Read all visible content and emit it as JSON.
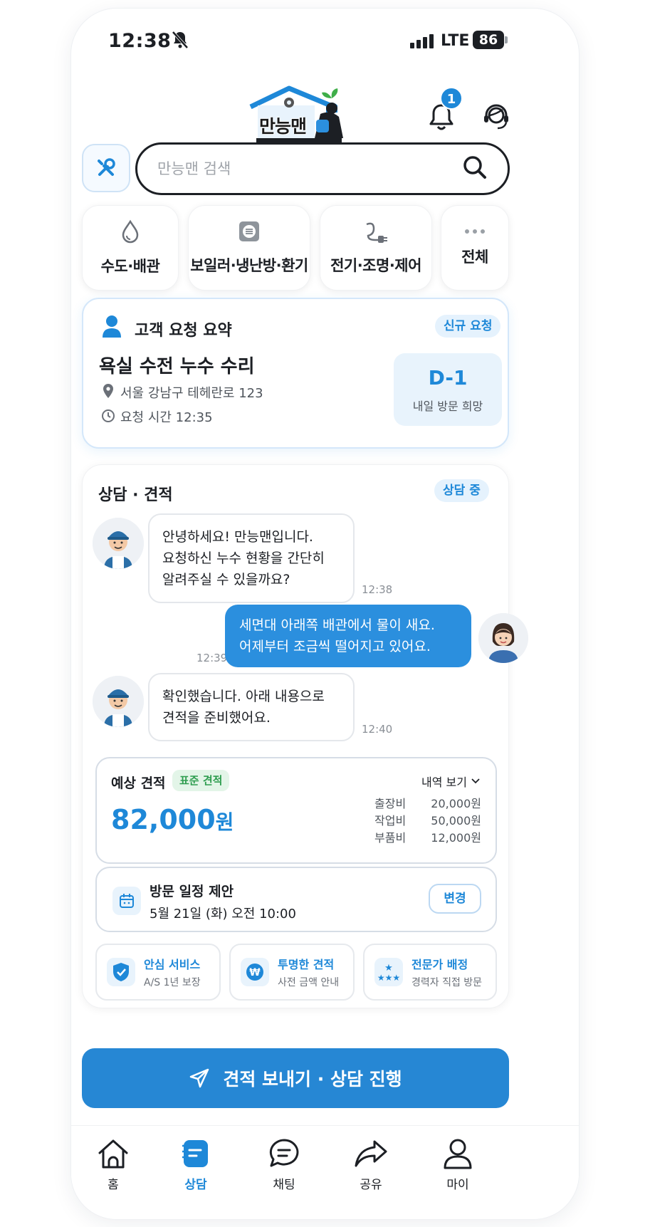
{
  "status_bar": {
    "time": "12:38",
    "network": "LTE",
    "battery": "86"
  },
  "header": {
    "logo_text": "만능맨",
    "notification_count": "1"
  },
  "search": {
    "placeholder": "만능맨 검색"
  },
  "categories": [
    {
      "label": "수도·배관",
      "icon": "water-drop-icon"
    },
    {
      "label": "보일러·냉난방·환기",
      "icon": "boiler-icon"
    },
    {
      "label": "전기·조명·제어",
      "icon": "plug-icon"
    },
    {
      "label": "전체",
      "icon": "more-dots-icon"
    }
  ],
  "summary": {
    "title": "고객 요청 요약",
    "badge": "신규 요청",
    "request": "욕실 수전 누수 수리",
    "address": "서울 강남구 테헤란로 123",
    "request_time": "요청 시간 12:35",
    "dday": "D-1",
    "dday_note": "내일 방문 희망"
  },
  "consult": {
    "title": "상담 · 견적",
    "status": "상담 중",
    "messages": [
      {
        "sender": "expert",
        "lines": [
          "안녕하세요! 만능맨입니다.",
          "요청하신 누수 현황을 간단히",
          "알려주실 수 있을까요?"
        ],
        "time": "12:38"
      },
      {
        "sender": "customer",
        "lines": [
          "세면대 아래쪽 배관에서 물이 새요.",
          "어제부터 조금씩 떨어지고 있어요."
        ],
        "time": "12:39"
      },
      {
        "sender": "expert",
        "lines": [
          "확인했습니다. 아래 내용으로",
          "견적을 준비했어요."
        ],
        "time": "12:40"
      }
    ],
    "estimate": {
      "label": "예상 견적",
      "tag": "표준 견적",
      "details_link": "내역 보기",
      "amount": "82,000",
      "currency": "원",
      "items": [
        {
          "name": "출장비",
          "price": "20,000원"
        },
        {
          "name": "작업비",
          "price": "50,000원"
        },
        {
          "name": "부품비",
          "price": "12,000원"
        }
      ]
    },
    "schedule": {
      "title": "방문 일정 제안",
      "datetime": "5월 21일 (화) 오전 10:00",
      "change_label": "변경"
    },
    "features": [
      {
        "title": "안심 서비스",
        "sub": "A/S 1년 보장",
        "icon": "shield-check-icon"
      },
      {
        "title": "투명한 견적",
        "sub": "사전 금액 안내",
        "icon": "won-coin-icon"
      },
      {
        "title": "전문가 배정",
        "sub": "경력자 직접 방문",
        "icon": "stars-icon"
      }
    ]
  },
  "cta": {
    "label": "견적 보내기 · 상담 진행"
  },
  "nav": [
    {
      "label": "홈",
      "icon": "home-icon",
      "active": false
    },
    {
      "label": "상담",
      "icon": "consult-icon",
      "active": true
    },
    {
      "label": "채팅",
      "icon": "chat-icon",
      "active": false
    },
    {
      "label": "공유",
      "icon": "share-icon",
      "active": false
    },
    {
      "label": "마이",
      "icon": "person-icon",
      "active": false
    }
  ],
  "colors": {
    "accent": "#1e88d8",
    "cta": "#2687d4",
    "bubble_out": "#2b8fde",
    "tag_green": "#2e9d4f"
  }
}
